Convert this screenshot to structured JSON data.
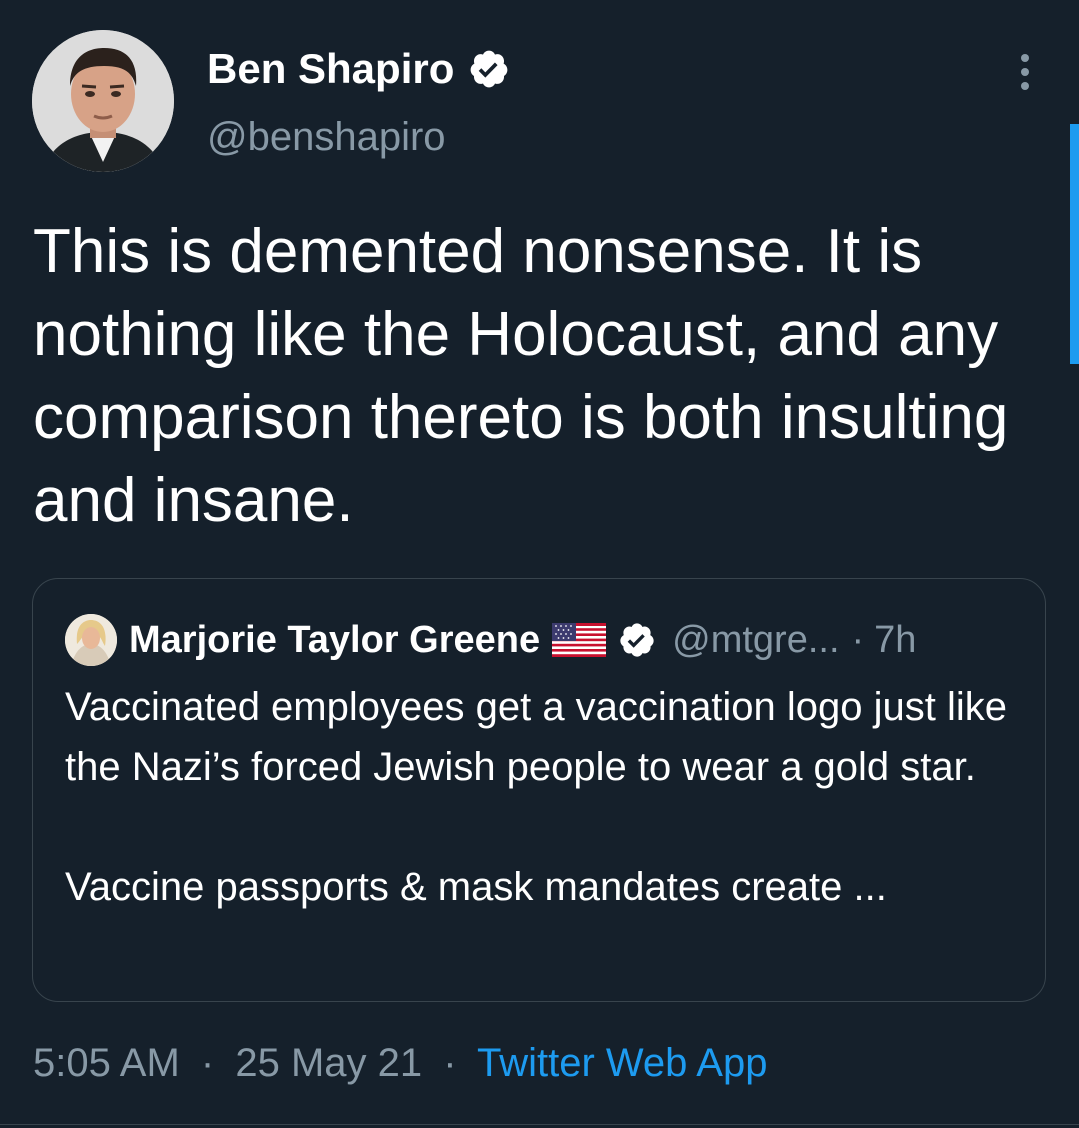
{
  "author": {
    "name": "Ben Shapiro",
    "handle": "@benshapiro",
    "verified": true,
    "avatar_icon": "profile-photo"
  },
  "tweet": {
    "text": "This is demented nonsense. It is nothing like the Holocaust, and any comparison thereto is both insulting and insane."
  },
  "quoted_tweet": {
    "name": "Marjorie Taylor Greene",
    "flag_icon": "us-flag-icon",
    "verified": true,
    "handle": "@mtgre...",
    "dot": "·",
    "time": "7h",
    "text_line1": "Vaccinated employees get a vaccination logo just like the Nazi’s forced Jewish people to wear a gold star.",
    "text_line2": "Vaccine passports & mask mandates create ..."
  },
  "meta": {
    "time": "5:05 AM",
    "sep1": "·",
    "date": "25 May 21",
    "sep2": "·",
    "source": "Twitter Web App"
  },
  "colors": {
    "background": "#15202b",
    "text": "#ffffff",
    "secondary": "#8899a6",
    "accent": "#1d9bf0",
    "border": "#38444d"
  }
}
